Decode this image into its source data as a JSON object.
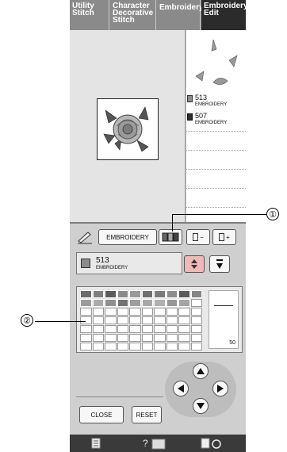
{
  "tabs": [
    {
      "label": "Utility Stitch"
    },
    {
      "label": "Character Decorative Stitch"
    },
    {
      "label": "Embroidery"
    },
    {
      "label": "Embroidery Edit"
    }
  ],
  "thread_list": [
    {
      "number": "513",
      "brand": "EMBROIDERY",
      "color": "#8c8c8c"
    },
    {
      "number": "507",
      "brand": "EMBROIDERY",
      "color": "#2e2e2e"
    }
  ],
  "toolbar": {
    "brand_label": "EMBROIDERY",
    "minus_label": "−",
    "plus_label": "+"
  },
  "selected_thread": {
    "number": "513",
    "brand": "EMBROIDERY",
    "color": "#8c8c8c"
  },
  "palette": {
    "rows": [
      [
        "#6b6b6b",
        "#7f7f7f",
        "#5c5c5c",
        "#8a8a8a",
        "#9a9a9a",
        "#6e6e6e",
        "#7a7a7a",
        "#8e8e8e",
        "#5a5a5a",
        "#858585"
      ],
      [
        "#9b9b9b",
        "#ababab",
        "#8f8f8f",
        "#747474",
        "#9e9e9e",
        "#a8a8a8",
        "#b0b0b0",
        "#979797",
        "#a5a5a5"
      ]
    ],
    "scroll_value": "50"
  },
  "buttons": {
    "close": "CLOSE",
    "reset": "RESET"
  },
  "callouts": {
    "one": "①",
    "two": "②"
  }
}
